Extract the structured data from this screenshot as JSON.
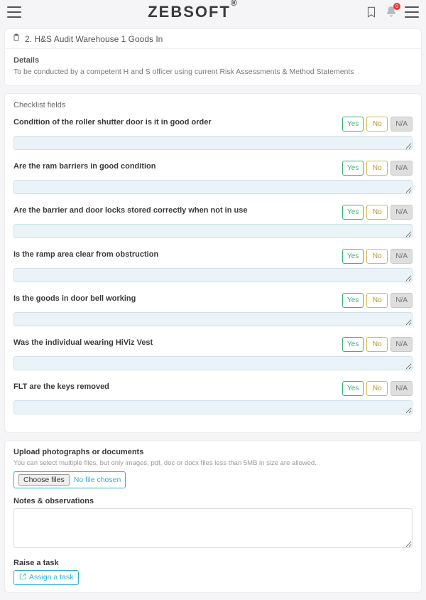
{
  "header": {
    "brand": "ZEBSOFT",
    "brand_sup": "®",
    "badge_count": "0"
  },
  "page": {
    "title": "2. H&S Audit Warehouse 1 Goods In",
    "details_heading": "Details",
    "details_text": "To be conducted by a competent H and S officer using current Risk Assessments & Method Statements"
  },
  "checklist": {
    "section_title": "Checklist fields",
    "yes_label": "Yes",
    "no_label": "No",
    "na_label": "N/A",
    "items": [
      {
        "q": "Condition of the roller shutter door is it in good order"
      },
      {
        "q": "Are the ram barriers in good condition"
      },
      {
        "q": "Are the barrier and door locks stored correctly when not in use"
      },
      {
        "q": "Is the ramp area clear from obstruction"
      },
      {
        "q": "Is the goods in door bell working"
      },
      {
        "q": "Was the individual wearing HiViz Vest"
      },
      {
        "q": "FLT are the keys removed"
      }
    ]
  },
  "upload": {
    "title": "Upload photographs or documents",
    "hint": "You can select multiple files, but only images, pdf, doc or docx files less than 5MB in size are allowed.",
    "choose_label": "Choose files",
    "no_file_label": "No file chosen"
  },
  "notes": {
    "title": "Notes & observations"
  },
  "raise": {
    "title": "Raise a task",
    "assign_label": "Assign a task"
  }
}
